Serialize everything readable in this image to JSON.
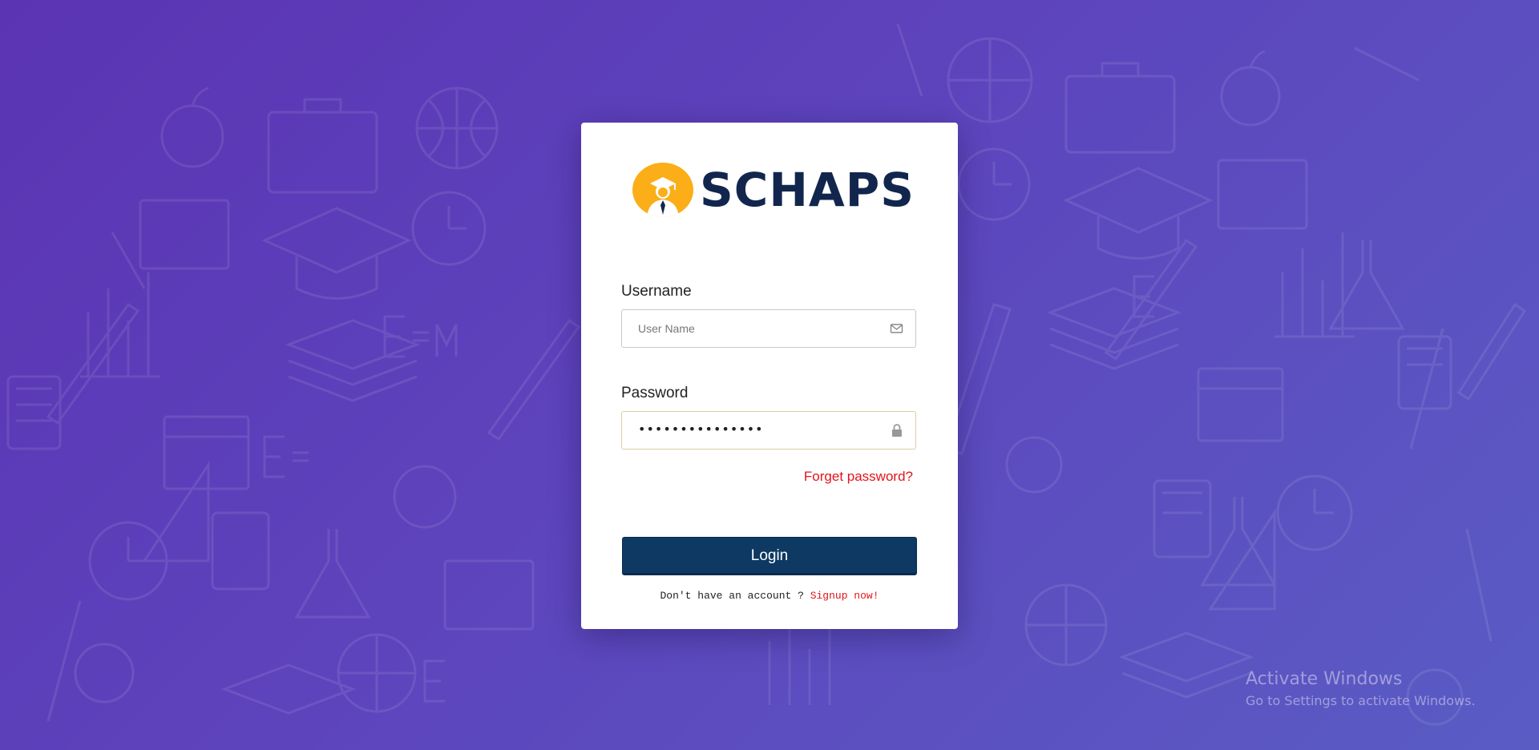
{
  "brand": {
    "name": "SCHAPS",
    "logo_color": "#fbae17",
    "text_color": "#12264d"
  },
  "login_form": {
    "username_label": "Username",
    "username_placeholder": "User Name",
    "username_icon": "envelope-icon",
    "password_label": "Password",
    "password_mask": "•••••••••••••••",
    "password_icon": "lock-icon",
    "forgot_link": "Forget password?",
    "login_button": "Login",
    "button_color": "#0d3963",
    "signup_prompt": "Don't have an account ? ",
    "signup_link": "Signup now!",
    "link_color": "#e2141b"
  },
  "watermark": {
    "title": "Activate Windows",
    "subtitle": "Go to Settings to activate Windows."
  },
  "background": {
    "gradient_start": "#5b34b3",
    "gradient_end": "#5a5cc4"
  }
}
